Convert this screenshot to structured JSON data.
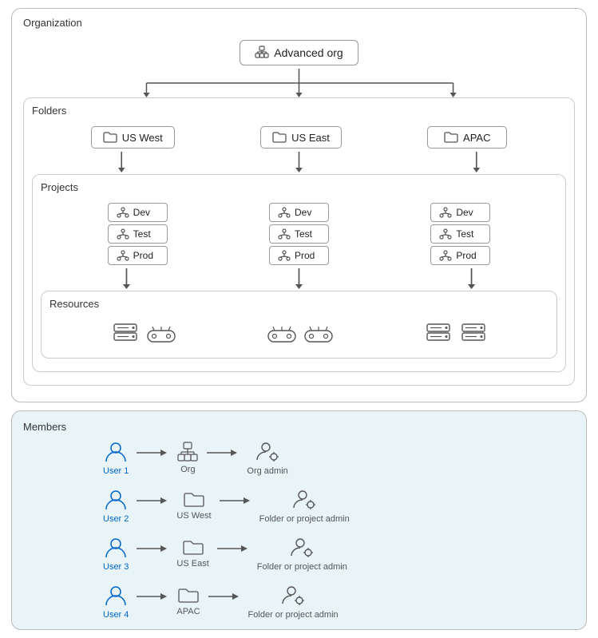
{
  "org": {
    "label": "Organization",
    "name": "Advanced org"
  },
  "folders": {
    "label": "Folders",
    "items": [
      "US West",
      "US East",
      "APAC"
    ]
  },
  "projects": {
    "label": "Projects",
    "groups": [
      [
        "Dev",
        "Test",
        "Prod"
      ],
      [
        "Dev",
        "Test",
        "Prod"
      ],
      [
        "Dev",
        "Test",
        "Prod"
      ]
    ]
  },
  "resources": {
    "label": "Resources"
  },
  "members": {
    "label": "Members",
    "rows": [
      {
        "user": "User 1",
        "target": "Org",
        "role": "Org admin"
      },
      {
        "user": "User 2",
        "target": "US West",
        "role": "Folder or project admin"
      },
      {
        "user": "User 3",
        "target": "US East",
        "role": "Folder or project admin"
      },
      {
        "user": "User 4",
        "target": "APAC",
        "role": "Folder or project admin"
      }
    ]
  }
}
